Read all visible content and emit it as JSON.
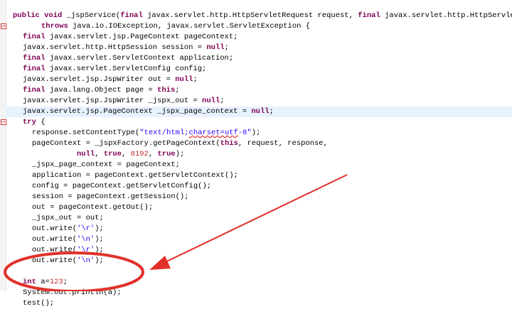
{
  "editor": {
    "lines": [
      {
        "indent": 18,
        "segments": [
          {
            "t": "public void ",
            "k": "kw"
          },
          {
            "t": "_jspService(",
            "k": ""
          },
          {
            "t": "final ",
            "k": "kw"
          },
          {
            "t": "javax.servlet.http.HttpServletRequest request, ",
            "k": ""
          },
          {
            "t": "final ",
            "k": "kw"
          },
          {
            "t": "javax.servlet.http.HttpServlet",
            "k": ""
          }
        ]
      },
      {
        "indent": 58,
        "segments": [
          {
            "t": "throws ",
            "k": "kw"
          },
          {
            "t": "java.io.IOException, javax.servlet.ServletException {",
            "k": ""
          }
        ]
      },
      {
        "indent": 32,
        "segments": [
          {
            "t": "final ",
            "k": "kw"
          },
          {
            "t": "javax.servlet.jsp.PageContext pageContext;",
            "k": ""
          }
        ]
      },
      {
        "indent": 32,
        "segments": [
          {
            "t": "javax.servlet.http.HttpSession session = ",
            "k": ""
          },
          {
            "t": "null",
            "k": "kw"
          },
          {
            "t": ";",
            "k": ""
          }
        ]
      },
      {
        "indent": 32,
        "segments": [
          {
            "t": "final ",
            "k": "kw"
          },
          {
            "t": "javax.servlet.ServletContext application;",
            "k": ""
          }
        ]
      },
      {
        "indent": 32,
        "segments": [
          {
            "t": "final ",
            "k": "kw"
          },
          {
            "t": "javax.servlet.ServletConfig config;",
            "k": ""
          }
        ]
      },
      {
        "indent": 32,
        "segments": [
          {
            "t": "javax.servlet.jsp.JspWriter out = ",
            "k": ""
          },
          {
            "t": "null",
            "k": "kw"
          },
          {
            "t": ";",
            "k": ""
          }
        ]
      },
      {
        "indent": 32,
        "segments": [
          {
            "t": "final ",
            "k": "kw"
          },
          {
            "t": "java.lang.Object page = ",
            "k": ""
          },
          {
            "t": "this",
            "k": "kw"
          },
          {
            "t": ";",
            "k": ""
          }
        ]
      },
      {
        "indent": 32,
        "segments": [
          {
            "t": "javax.servlet.jsp.JspWriter _jspx_out = ",
            "k": ""
          },
          {
            "t": "null",
            "k": "kw"
          },
          {
            "t": ";",
            "k": ""
          }
        ]
      },
      {
        "indent": 32,
        "highlight": true,
        "segments": [
          {
            "t": "javax.servlet.jsp.PageContext _jspx_page_context = ",
            "k": ""
          },
          {
            "t": "null",
            "k": "kw"
          },
          {
            "t": ";",
            "k": ""
          }
        ]
      },
      {
        "indent": 32,
        "segments": [
          {
            "t": "try ",
            "k": "kw"
          },
          {
            "t": "{",
            "k": ""
          }
        ]
      },
      {
        "indent": 45,
        "segments": [
          {
            "t": "response.setContentType(",
            "k": ""
          },
          {
            "t": "\"text/html;",
            "k": "str"
          },
          {
            "t": "charset=utf",
            "k": "squig"
          },
          {
            "t": "-8\"",
            "k": "str"
          },
          {
            "t": ");",
            "k": ""
          }
        ]
      },
      {
        "indent": 45,
        "segments": [
          {
            "t": "pageContext = _jspxFactory.getPageContext(",
            "k": ""
          },
          {
            "t": "this",
            "k": "kw"
          },
          {
            "t": ", request, response,",
            "k": ""
          }
        ]
      },
      {
        "indent": 108,
        "segments": [
          {
            "t": "null",
            "k": "kw"
          },
          {
            "t": ", ",
            "k": ""
          },
          {
            "t": "true",
            "k": "kw"
          },
          {
            "t": ", ",
            "k": ""
          },
          {
            "t": "8192",
            "k": "num"
          },
          {
            "t": ", ",
            "k": ""
          },
          {
            "t": "true",
            "k": "kw"
          },
          {
            "t": ");",
            "k": ""
          }
        ]
      },
      {
        "indent": 45,
        "segments": [
          {
            "t": "_jspx_page_context = pageContext;",
            "k": ""
          }
        ]
      },
      {
        "indent": 45,
        "segments": [
          {
            "t": "application = pageContext.getServletContext();",
            "k": ""
          }
        ]
      },
      {
        "indent": 45,
        "segments": [
          {
            "t": "config = pageContext.getServletConfig();",
            "k": ""
          }
        ]
      },
      {
        "indent": 45,
        "segments": [
          {
            "t": "session = pageContext.getSession();",
            "k": ""
          }
        ]
      },
      {
        "indent": 45,
        "segments": [
          {
            "t": "out = pageContext.getOut();",
            "k": ""
          }
        ]
      },
      {
        "indent": 45,
        "segments": [
          {
            "t": "_jspx_out = out;",
            "k": ""
          }
        ]
      },
      {
        "indent": 45,
        "segments": [
          {
            "t": "out.write(",
            "k": ""
          },
          {
            "t": "'\\r'",
            "k": "str"
          },
          {
            "t": ");",
            "k": ""
          }
        ]
      },
      {
        "indent": 45,
        "segments": [
          {
            "t": "out.write(",
            "k": ""
          },
          {
            "t": "'\\n'",
            "k": "str"
          },
          {
            "t": ");",
            "k": ""
          }
        ]
      },
      {
        "indent": 45,
        "segments": [
          {
            "t": "out.write(",
            "k": ""
          },
          {
            "t": "'\\r'",
            "k": "str"
          },
          {
            "t": ");",
            "k": ""
          }
        ]
      },
      {
        "indent": 45,
        "segments": [
          {
            "t": "out.write(",
            "k": ""
          },
          {
            "t": "'\\n'",
            "k": "str"
          },
          {
            "t": ");",
            "k": ""
          }
        ]
      },
      {
        "indent": 45,
        "segments": []
      },
      {
        "indent": 32,
        "segments": [
          {
            "t": "int ",
            "k": "kw"
          },
          {
            "t": "a=",
            "k": ""
          },
          {
            "t": "123",
            "k": "num"
          },
          {
            "t": ";",
            "k": ""
          }
        ]
      },
      {
        "indent": 32,
        "segments": [
          {
            "t": "System.out.println(a);",
            "k": ""
          }
        ]
      },
      {
        "indent": 32,
        "segments": [
          {
            "t": "test();",
            "k": ""
          }
        ]
      }
    ],
    "colors": {
      "keyword": "#7f0055",
      "string": "#2a00ff",
      "number": "#c62828",
      "annotation": "#e0312a",
      "highlight": "#e8f2fe"
    },
    "annotation_shapes": [
      "ellipse",
      "arrow"
    ]
  }
}
